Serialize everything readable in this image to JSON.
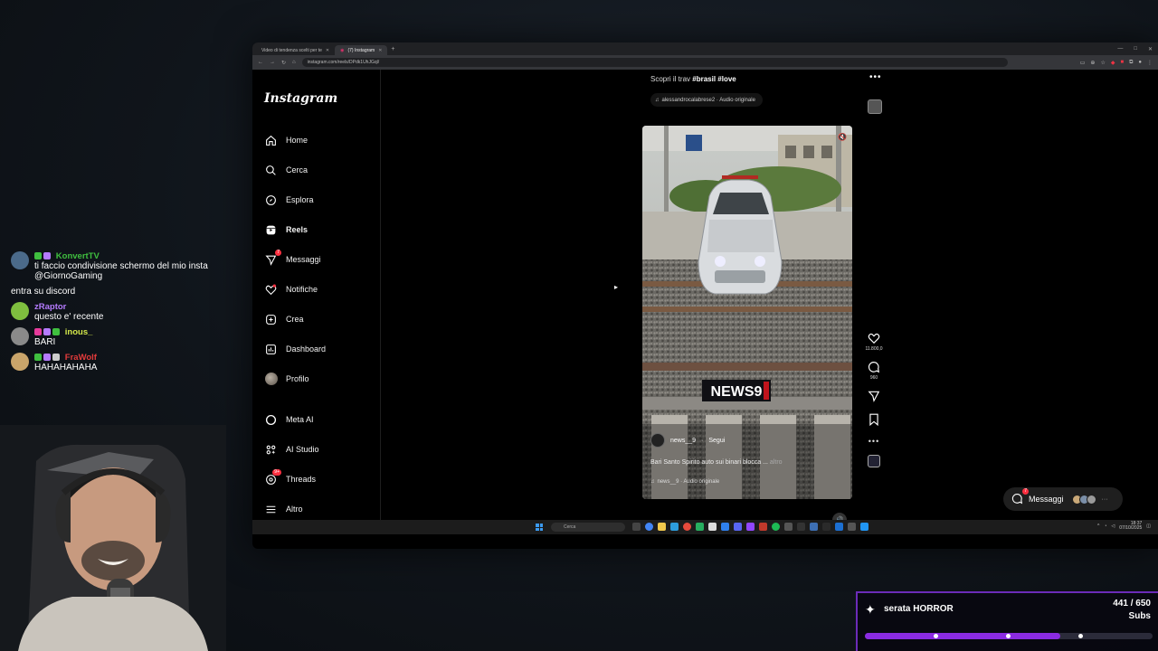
{
  "browser": {
    "tabs": [
      {
        "label": "Video di tendenza scelti per te"
      },
      {
        "label": "(7) Instagram"
      }
    ],
    "url": "instagram.com/reels/DPdk1UhJGql/"
  },
  "instagram": {
    "logo": "Instagram",
    "nav": [
      {
        "label": "Home",
        "icon": "home-icon"
      },
      {
        "label": "Cerca",
        "icon": "search-icon"
      },
      {
        "label": "Esplora",
        "icon": "compass-icon"
      },
      {
        "label": "Reels",
        "icon": "reels-icon"
      },
      {
        "label": "Messaggi",
        "icon": "send-icon",
        "badge": "7"
      },
      {
        "label": "Notifiche",
        "icon": "heart-icon"
      },
      {
        "label": "Crea",
        "icon": "plus-square-icon"
      },
      {
        "label": "Dashboard",
        "icon": "chart-icon"
      },
      {
        "label": "Profilo",
        "icon": "avatar"
      },
      {
        "label": "Meta AI",
        "icon": "meta-ai-icon"
      },
      {
        "label": "AI Studio",
        "icon": "ai-studio-icon"
      },
      {
        "label": "Threads",
        "icon": "threads-icon",
        "badge": "9+"
      },
      {
        "label": "Altro",
        "icon": "menu-icon"
      }
    ],
    "reel": {
      "header_prefix": "Scopri il trav",
      "header_tags": "#brasil #love",
      "top_audio": "alessandrocalabrese2 · Audio originale",
      "overlay_logo": "NEWS9",
      "author": "news__9",
      "follow": "Segui",
      "caption": "Bari Santo Spirito auto sui binari blocca ...",
      "caption_more": "altro",
      "audio": "news__9 · Audio originale",
      "likes": "11.800,0",
      "comments": "960"
    },
    "messages_pill": {
      "label": "Messaggi",
      "badge": "7"
    }
  },
  "taskbar": {
    "search_placeholder": "Cerca",
    "time": "18:37",
    "date": "07/10/2025"
  },
  "chat": [
    {
      "name": "KonvertTV",
      "name_color": "#3fbf3f",
      "text": "ti faccio condivisione schermo del mio insta @GiornoGaming",
      "avatar": "#4b6a8a"
    },
    {
      "name": "",
      "name_color": "#ffffff",
      "text": "entra su discord",
      "avatar": ""
    },
    {
      "name": "zRaptor",
      "name_color": "#b57bff",
      "text": "questo e' recente",
      "avatar": "#7fbf3f"
    },
    {
      "name": "inous_",
      "name_color": "#d4e84a",
      "text": "BARI",
      "avatar": "#8a8a8a"
    },
    {
      "name": "FraWolf",
      "name_color": "#e33b3b",
      "text": "HAHAHAHAHA",
      "avatar": "#c9a46a"
    }
  ],
  "sub_goal": {
    "title": "serata HORROR",
    "current": 441,
    "target": 650,
    "count_label": "441 / 650",
    "unit": "Subs",
    "progress": 0.678
  },
  "colors": {
    "accent_purple": "#8a2be2",
    "notification_red": "#ff3040",
    "windows_blue": "#3b9af0"
  }
}
